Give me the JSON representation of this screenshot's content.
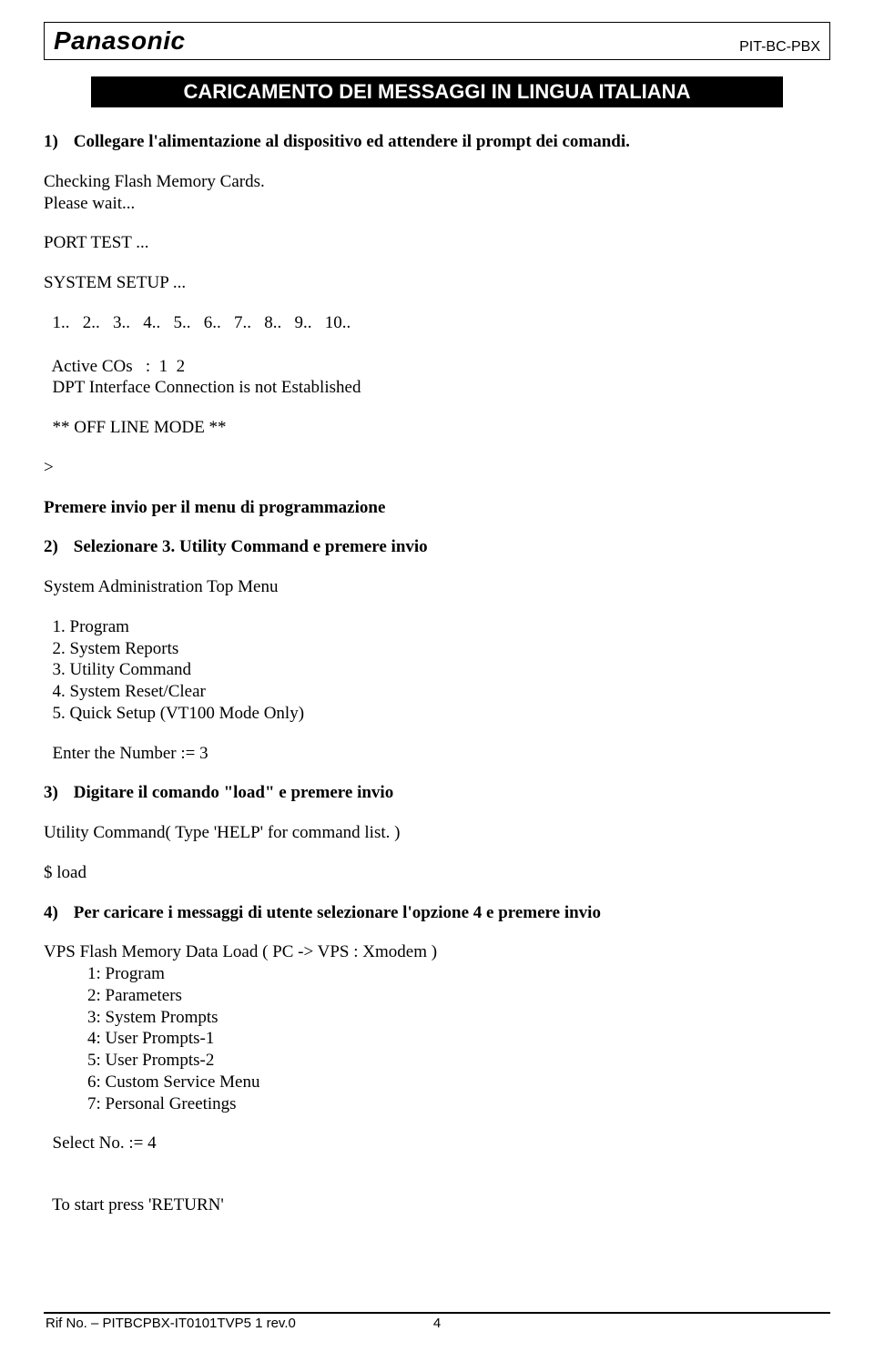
{
  "header": {
    "brand": "Panasonic",
    "doc_code": "PIT-BC-PBX"
  },
  "banner": "CARICAMENTO DEI MESSAGGI IN LINGUA ITALIANA",
  "step1": {
    "num": "1)",
    "text": "Collegare l'alimentazione al dispositivo ed attendere il prompt dei comandi."
  },
  "term1": {
    "l1": "Checking Flash Memory Cards.",
    "l2": "Please wait...",
    "l3": "PORT TEST ...",
    "l4": "SYSTEM SETUP ...",
    "l5": "  1..   2..   3..   4..   5..   6..   7..   8..   9..   10..",
    "l6": "  Active COs   :  1  2",
    "l7": "  DPT Interface Connection is not Established",
    "l8": "  ** OFF LINE MODE **",
    "l9": ">"
  },
  "premere": "Premere invio per il menu di programmazione",
  "step2": {
    "num": "2)",
    "text": "Selezionare 3.  Utility  Command  e premere invio"
  },
  "menu_title": "System Administration Top Menu",
  "menu": {
    "i1": "  1. Program",
    "i2": "  2. System Reports",
    "i3": "  3. Utility Command",
    "i4": "  4. System Reset/Clear",
    "i5": "  5. Quick Setup (VT100 Mode Only)"
  },
  "enter_num": "  Enter the Number := 3",
  "step3": {
    "num": "3)",
    "text": "Digitare il comando \"load\" e premere invio"
  },
  "util_cmd": "Utility Command( Type 'HELP' for command list. )",
  "load_line": "$  load",
  "step4": {
    "num": "4)",
    "text": "Per caricare i messaggi di utente selezionare l'opzione 4 e premere invio"
  },
  "vps_title": "VPS Flash Memory Data Load ( PC -> VPS : Xmodem )",
  "vps": {
    "o1": "1: Program",
    "o2": "2: Parameters",
    "o3": "3: System Prompts",
    "o4": "4: User Prompts-1",
    "o5": "5: User Prompts-2",
    "o6": "6: Custom Service Menu",
    "o7": "7: Personal Greetings"
  },
  "select_no": "  Select No. := 4",
  "start_ret": "  To start press 'RETURN'",
  "footer": {
    "ref": "Rif No. – PITBCPBX-IT0101TVP5 1 rev.0",
    "page": "4"
  }
}
